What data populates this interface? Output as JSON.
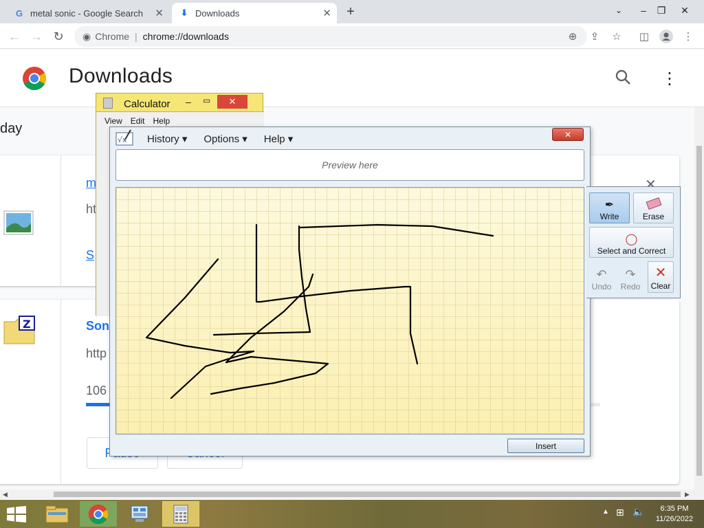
{
  "browser": {
    "tabs": [
      {
        "label": "metal sonic - Google Search",
        "icon": "google-icon"
      },
      {
        "label": "Downloads",
        "icon": "download-icon"
      }
    ],
    "new_tab_icon": "plus-icon",
    "omnibox": {
      "site": "Chrome",
      "url": "chrome://downloads"
    }
  },
  "downloads": {
    "title": "Downloads",
    "date_header": "day",
    "items": [
      {
        "icon": "image-file-icon",
        "name": "m",
        "url": "ht",
        "action": "S"
      },
      {
        "icon": "zip-file-icon",
        "name": "Son",
        "url": "http",
        "status": "106",
        "buttons": [
          "Pause",
          "Cancel"
        ]
      }
    ]
  },
  "calculator": {
    "title": "Calculator",
    "menu": [
      "View",
      "Edit",
      "Help"
    ]
  },
  "math_input": {
    "menu": [
      "History",
      "Options",
      "Help"
    ],
    "preview_placeholder": "Preview here",
    "insert_label": "Insert",
    "tools": [
      {
        "label": "Write",
        "icon": "pen-icon",
        "selected": true
      },
      {
        "label": "Erase",
        "icon": "eraser-icon"
      },
      {
        "label": "Select and Correct",
        "icon": "lasso-icon"
      },
      {
        "label": "Undo",
        "icon": "undo-icon",
        "disabled": true
      },
      {
        "label": "Redo",
        "icon": "redo-icon",
        "disabled": true
      },
      {
        "label": "Clear",
        "icon": "clear-icon"
      }
    ]
  },
  "taskbar": {
    "apps": [
      "file-explorer-icon",
      "chrome-icon",
      "control-panel-icon",
      "calculator-icon"
    ],
    "time": "6:35 PM",
    "date": "11/26/2022"
  },
  "colors": {
    "accent": "#1a73e8",
    "canvas": "#fdf7d4",
    "calc": "#f5e675"
  }
}
